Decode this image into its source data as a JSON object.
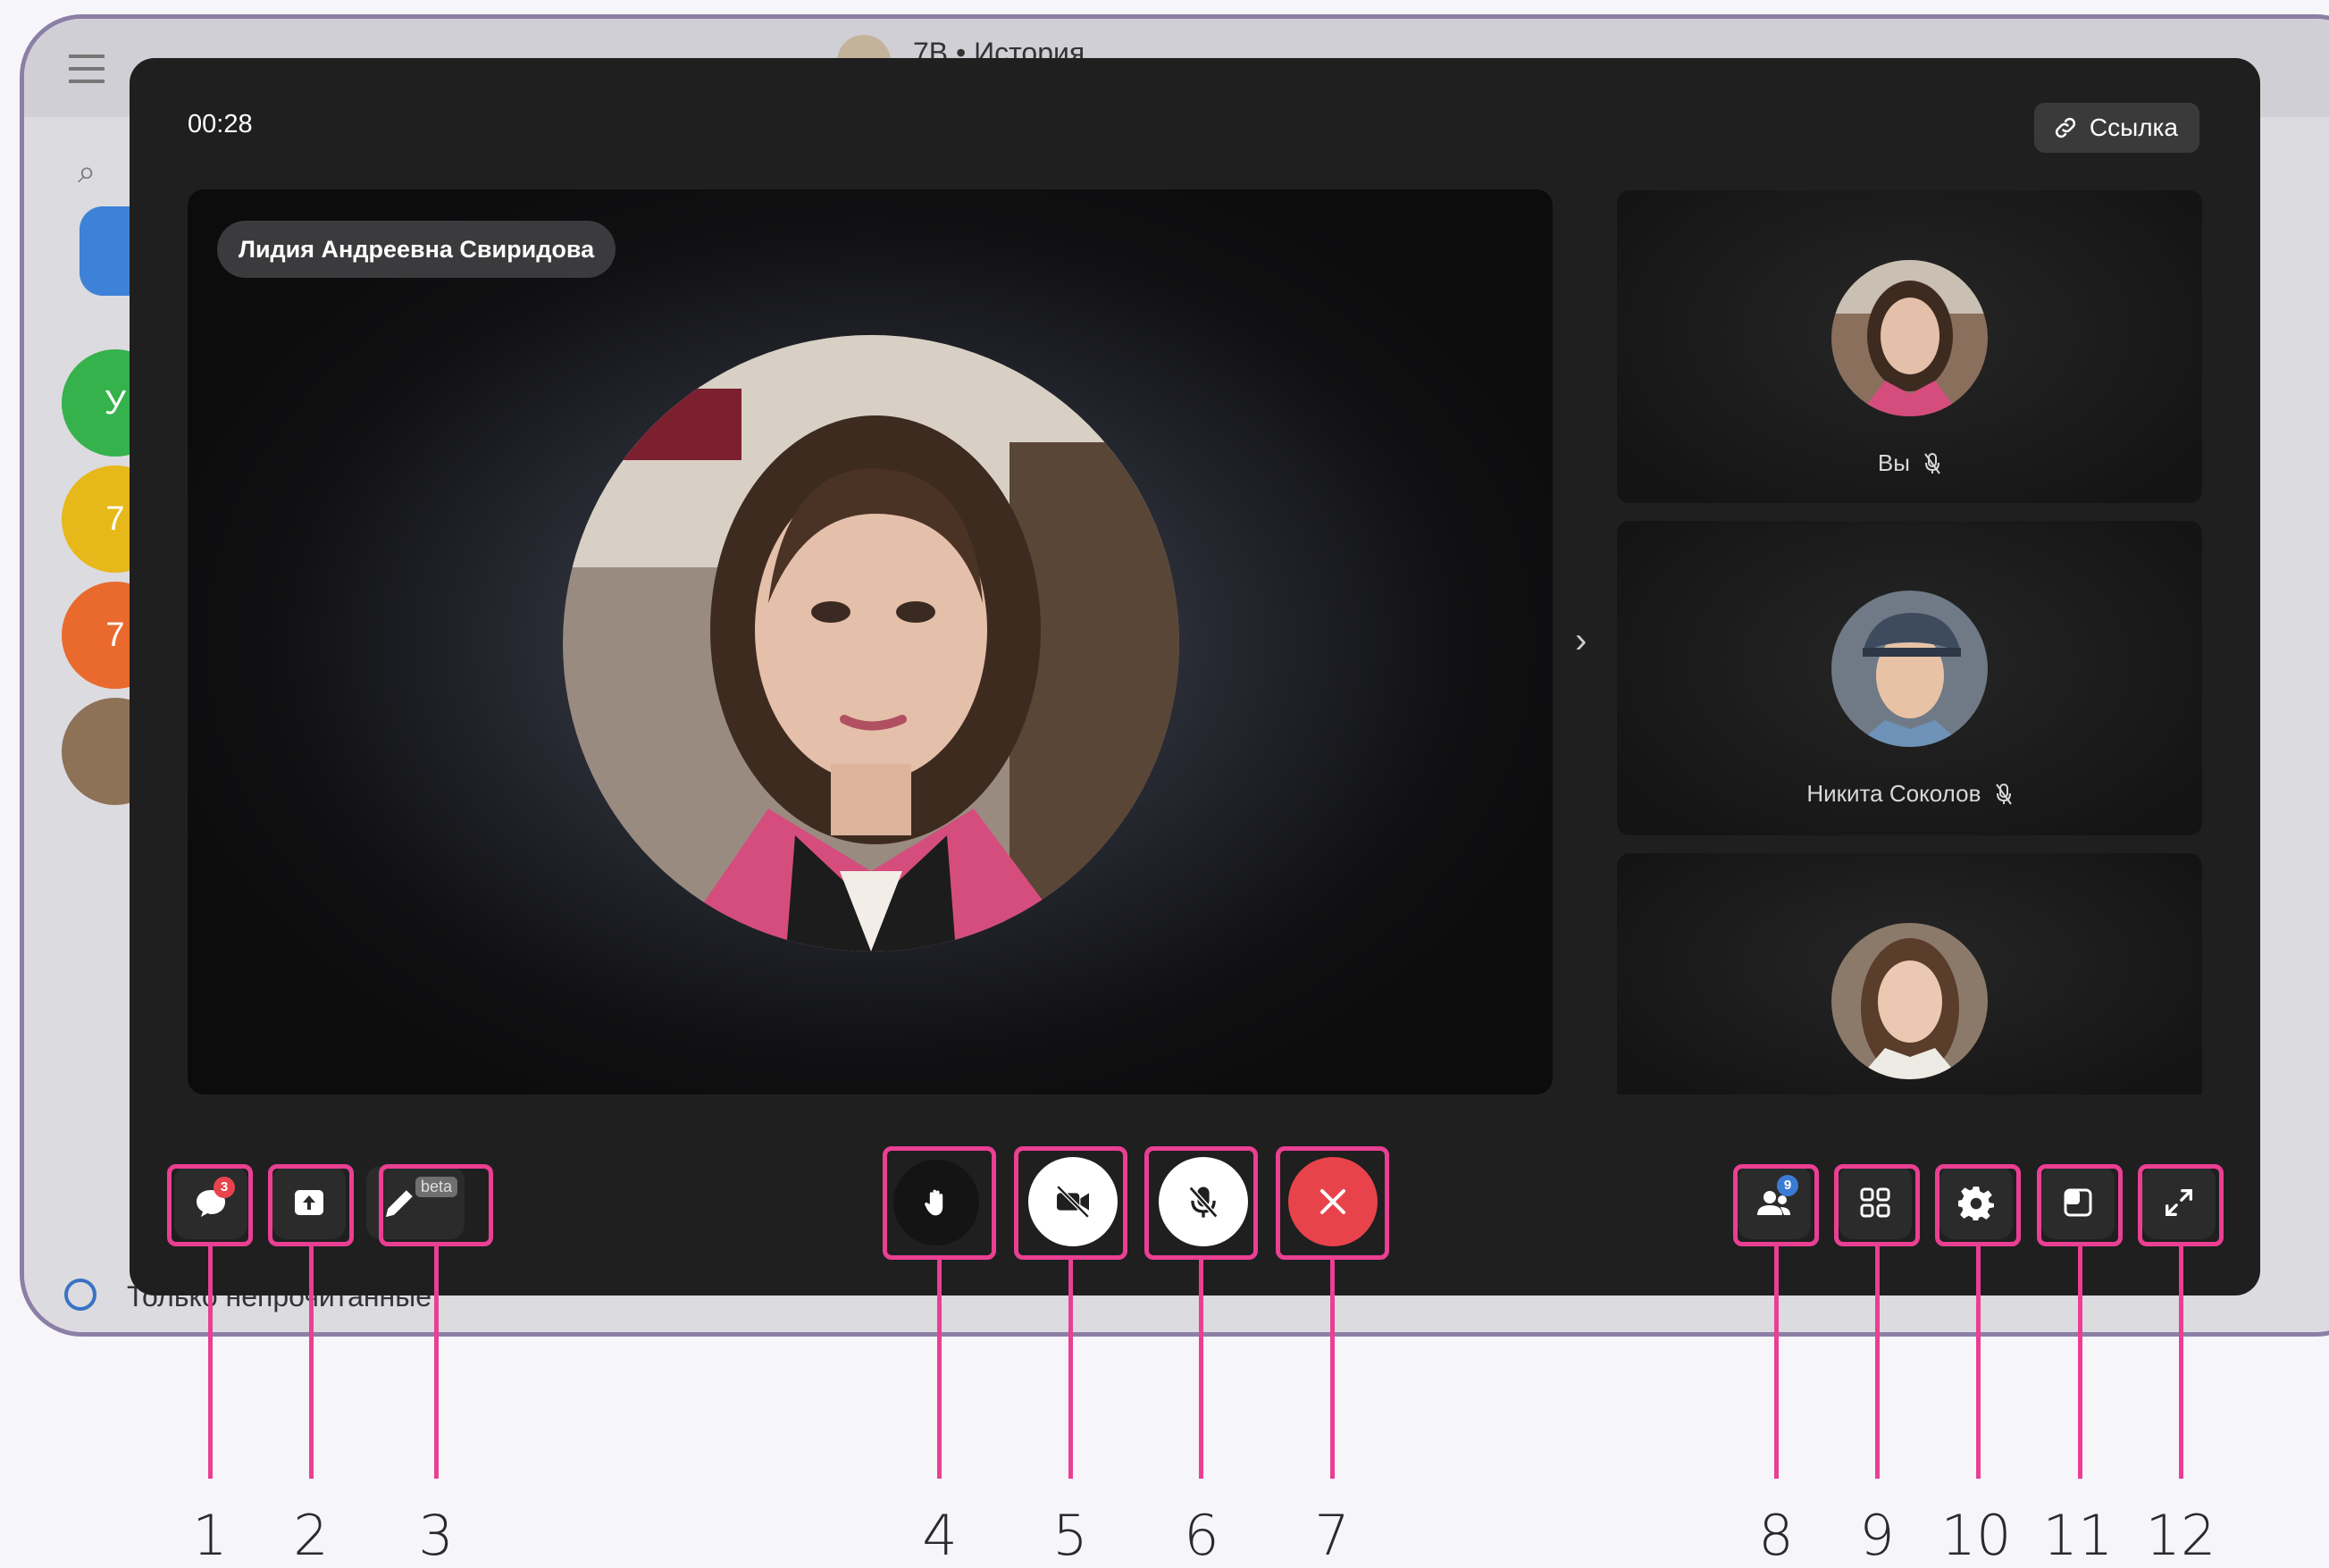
{
  "background_app": {
    "header_title": "7В • История",
    "chat_initials": [
      "У",
      "7",
      "7"
    ],
    "filter_label": "Только непрочитанные"
  },
  "call": {
    "timer": "00:28",
    "link_button_label": "Ссылка",
    "main_speaker": "Лидия Андреевна Свиридова",
    "tiles": [
      {
        "label": "Вы",
        "muted": true
      },
      {
        "label": "Никита Соколов",
        "muted": true
      },
      {
        "label": "",
        "muted": false
      }
    ]
  },
  "controls": {
    "chat_unread": "3",
    "draw_badge": "beta",
    "participants_count": "9"
  },
  "annotations": [
    "1",
    "2",
    "3",
    "4",
    "5",
    "6",
    "7",
    "8",
    "9",
    "10",
    "11",
    "12"
  ],
  "colors": {
    "highlight": "#ea3f93",
    "end_call": "#e8434b",
    "badge_red": "#e8434b",
    "badge_blue": "#3a7bd5"
  }
}
